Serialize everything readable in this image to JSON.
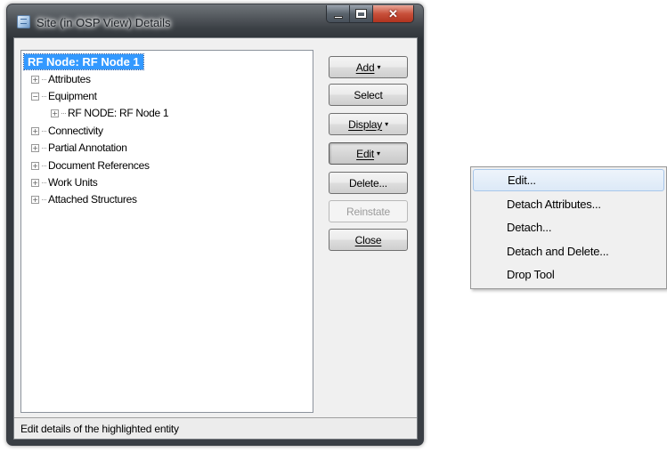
{
  "window": {
    "title": "Site (in OSP View) Details",
    "controls": {
      "minimize": "",
      "maximize": "",
      "close": "✕"
    }
  },
  "tree": {
    "root": "RF Node: RF Node 1",
    "items": [
      {
        "label": "Attributes",
        "expander": "+"
      },
      {
        "label": "Equipment",
        "expander": "−"
      },
      {
        "label": "RF NODE: RF Node 1",
        "expander": "+"
      },
      {
        "label": "Connectivity",
        "expander": "+"
      },
      {
        "label": "Partial Annotation",
        "expander": "+"
      },
      {
        "label": "Document References",
        "expander": "+"
      },
      {
        "label": "Work Units",
        "expander": "+"
      },
      {
        "label": "Attached Structures",
        "expander": "+"
      }
    ]
  },
  "buttons": {
    "add": {
      "label": "Add",
      "arrow": "▾"
    },
    "select": {
      "label": "Select"
    },
    "display": {
      "label": "Display",
      "arrow": "▾"
    },
    "edit": {
      "label": "Edit",
      "arrow": "▾"
    },
    "delete": {
      "label": "Delete..."
    },
    "reinstate": {
      "label": "Reinstate"
    },
    "close": {
      "label": "Close"
    }
  },
  "status": {
    "text": "Edit details of the highlighted entity"
  },
  "context_menu": {
    "items": [
      {
        "label": "Edit...",
        "highlighted": true
      },
      {
        "label": "Detach Attributes..."
      },
      {
        "label": "Detach..."
      },
      {
        "label": "Detach and Delete..."
      },
      {
        "label": "Drop Tool"
      }
    ]
  }
}
